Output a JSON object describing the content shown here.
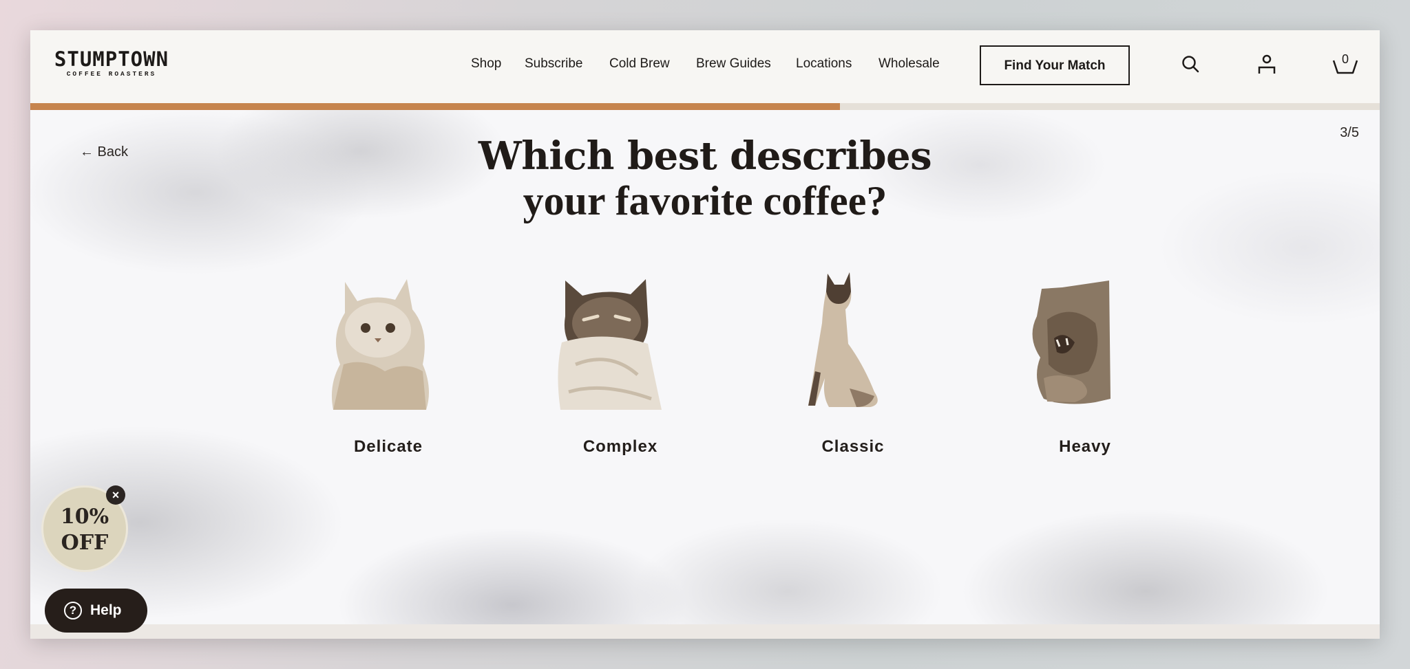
{
  "brand": {
    "name": "STUMPTOWN",
    "tagline": "COFFEE ROASTERS"
  },
  "nav": [
    {
      "label": "Shop"
    },
    {
      "label": "Subscribe"
    },
    {
      "label": "Cold Brew"
    },
    {
      "label": "Brew Guides"
    },
    {
      "label": "Locations"
    },
    {
      "label": "Wholesale"
    }
  ],
  "cta": {
    "label": "Find Your Match"
  },
  "cart": {
    "count": "0"
  },
  "icons": {
    "search": "search-icon",
    "account": "account-icon",
    "cart": "cart-icon"
  },
  "quiz": {
    "back_label": "← Back",
    "step": "3/5",
    "progress": 0.6,
    "title_line1": "Which best describes",
    "title_line2": "your favorite coffee?",
    "options": [
      {
        "label": "Delicate"
      },
      {
        "label": "Complex"
      },
      {
        "label": "Classic"
      },
      {
        "label": "Heavy"
      }
    ]
  },
  "promo": {
    "line1": "10%",
    "line2": "OFF",
    "close": "×"
  },
  "help": {
    "label": "Help",
    "icon": "?"
  },
  "colors": {
    "accent": "#c6844d",
    "track": "#e5e0d8",
    "text": "#1d1a18",
    "promo_bg": "#dcd5bd"
  }
}
